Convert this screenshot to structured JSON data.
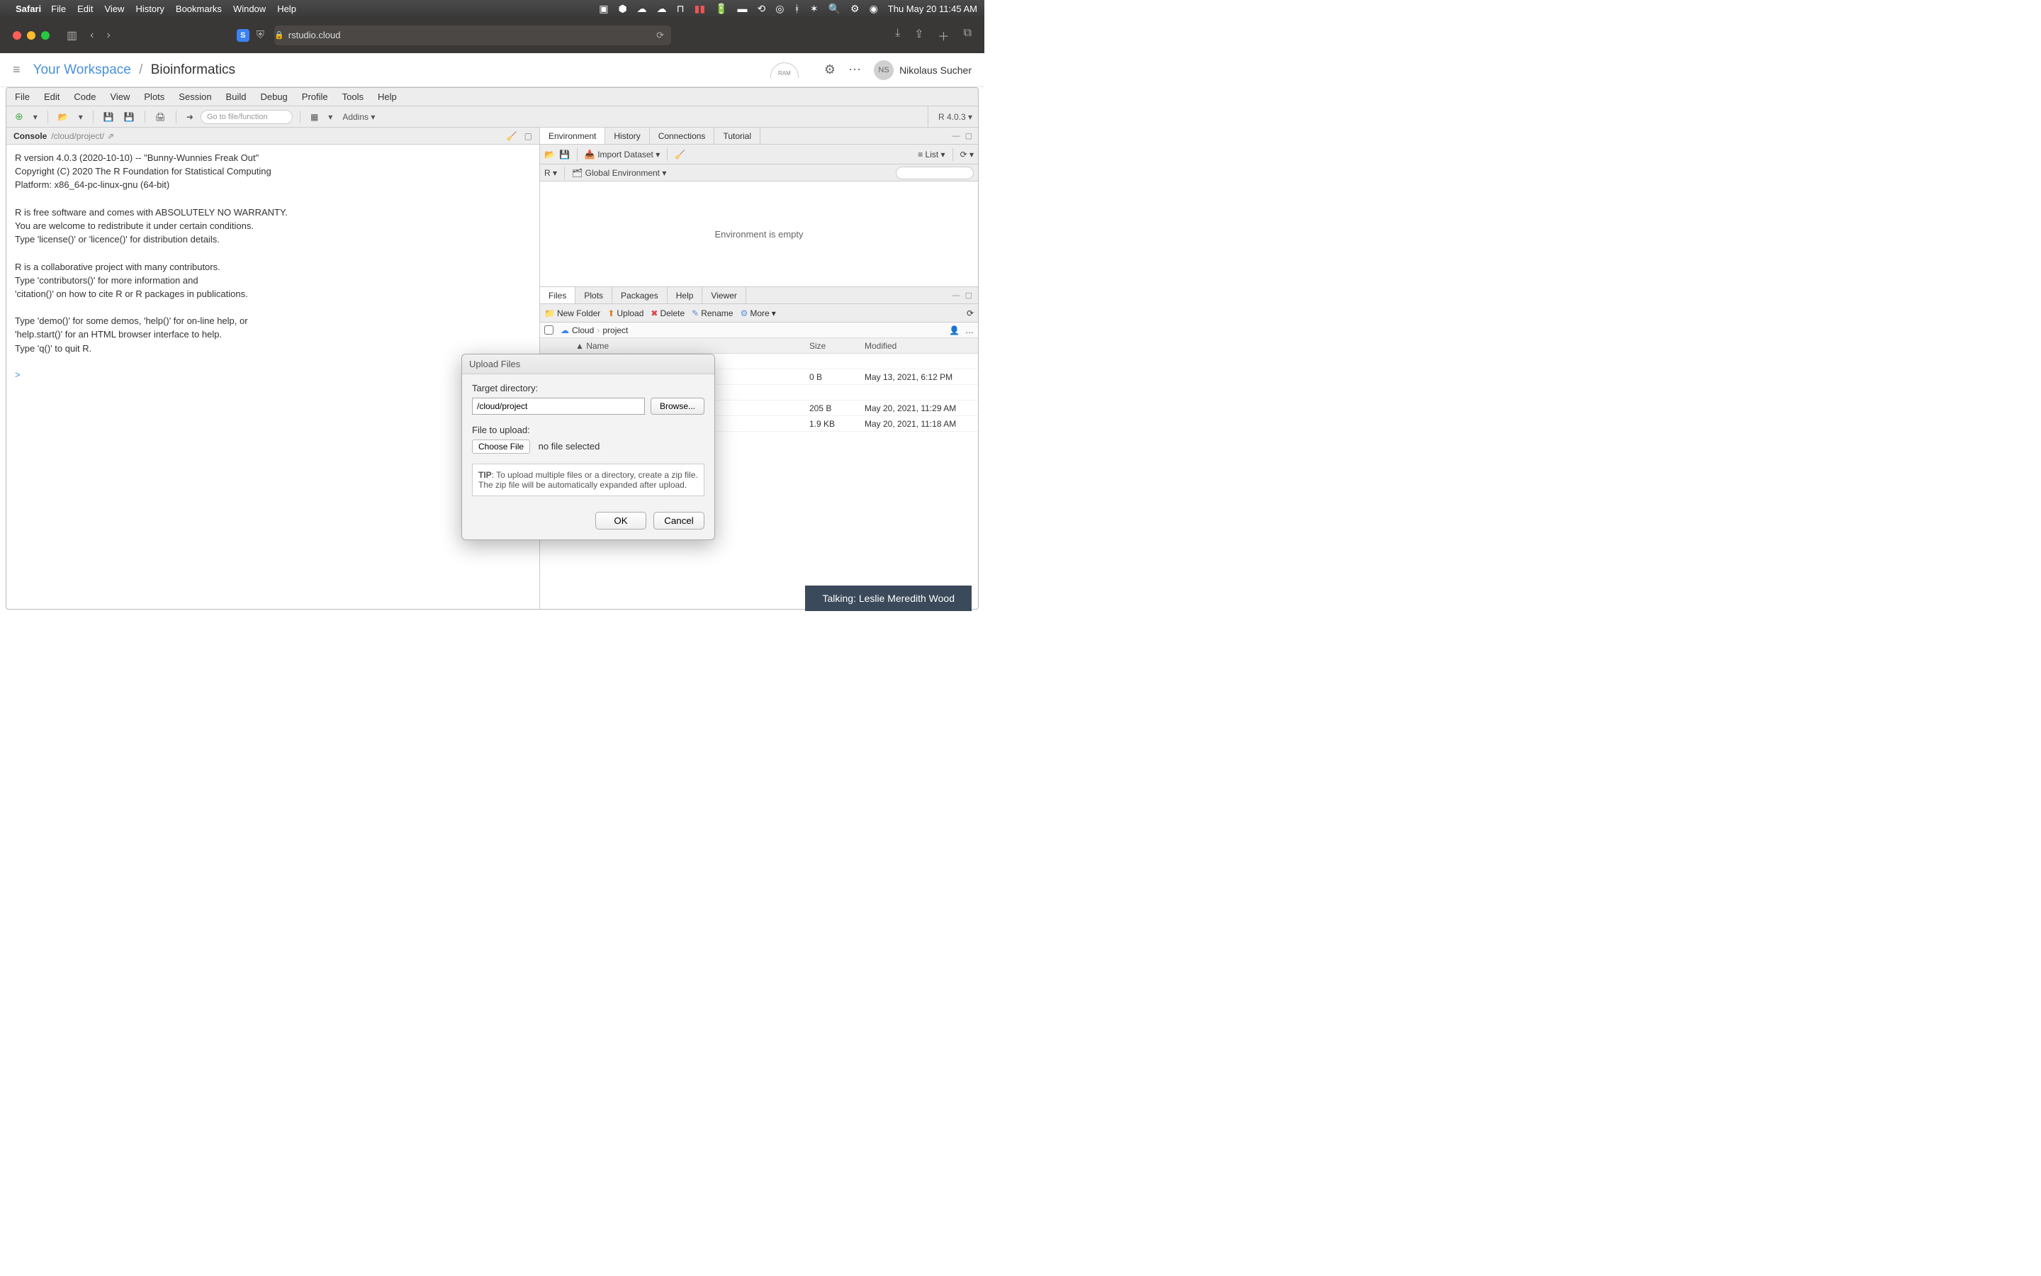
{
  "menubar": {
    "app": "Safari",
    "items": [
      "File",
      "Edit",
      "View",
      "History",
      "Bookmarks",
      "Window",
      "Help"
    ],
    "clock": "Thu May 20  11:45 AM"
  },
  "safari": {
    "site_badge": "S",
    "url_host": "rstudio.cloud"
  },
  "rheader": {
    "workspace": "Your Workspace",
    "project": "Bioinformatics",
    "ram_label": "RAM",
    "avatar": "NS",
    "user": "Nikolaus Sucher"
  },
  "ide": {
    "menus": [
      "File",
      "Edit",
      "Code",
      "View",
      "Plots",
      "Session",
      "Build",
      "Debug",
      "Profile",
      "Tools",
      "Help"
    ],
    "gotofile_ph": "Go to file/function",
    "addins": "Addins",
    "rversion": "R 4.0.3"
  },
  "console": {
    "tab": "Console",
    "path": "/cloud/project/",
    "text": "R version 4.0.3 (2020-10-10) -- \"Bunny-Wunnies Freak Out\"\nCopyright (C) 2020 The R Foundation for Statistical Computing\nPlatform: x86_64-pc-linux-gnu (64-bit)\n\nR is free software and comes with ABSOLUTELY NO WARRANTY.\nYou are welcome to redistribute it under certain conditions.\nType 'license()' or 'licence()' for distribution details.\n\nR is a collaborative project with many contributors.\nType 'contributors()' for more information and\n'citation()' on how to cite R or R packages in publications.\n\nType 'demo()' for some demos, 'help()' for on-line help, or\n'help.start()' for an HTML browser interface to help.\nType 'q()' to quit R.\n",
    "prompt": ">"
  },
  "env": {
    "tabs": [
      "Environment",
      "History",
      "Connections",
      "Tutorial"
    ],
    "import": "Import Dataset",
    "list": "List",
    "r_label": "R",
    "global": "Global Environment",
    "empty": "Environment is empty"
  },
  "files": {
    "tabs": [
      "Files",
      "Plots",
      "Packages",
      "Help",
      "Viewer"
    ],
    "btn_newfolder": "New Folder",
    "btn_upload": "Upload",
    "btn_delete": "Delete",
    "btn_rename": "Rename",
    "btn_more": "More",
    "crumb_cloud": "Cloud",
    "crumb_project": "project",
    "col_name": "Name",
    "col_size": "Size",
    "col_mod": "Modified",
    "rows": [
      {
        "size": "0 B",
        "mod": "May 13, 2021, 6:12 PM"
      },
      {
        "size": "205 B",
        "mod": "May 20, 2021, 11:29 AM"
      },
      {
        "size": "1.9 KB",
        "mod": "May 20, 2021, 11:18 AM"
      }
    ]
  },
  "dialog": {
    "title": "Upload Files",
    "target_label": "Target directory:",
    "target_value": "/cloud/project",
    "browse": "Browse...",
    "file_label": "File to upload:",
    "choose": "Choose File",
    "nofile": "no file selected",
    "tip_bold": "TIP",
    "tip_text": ": To upload multiple files or a directory, create a zip file. The zip file will be automatically expanded after upload.",
    "ok": "OK",
    "cancel": "Cancel"
  },
  "talking": "Talking: Leslie Meredith Wood"
}
